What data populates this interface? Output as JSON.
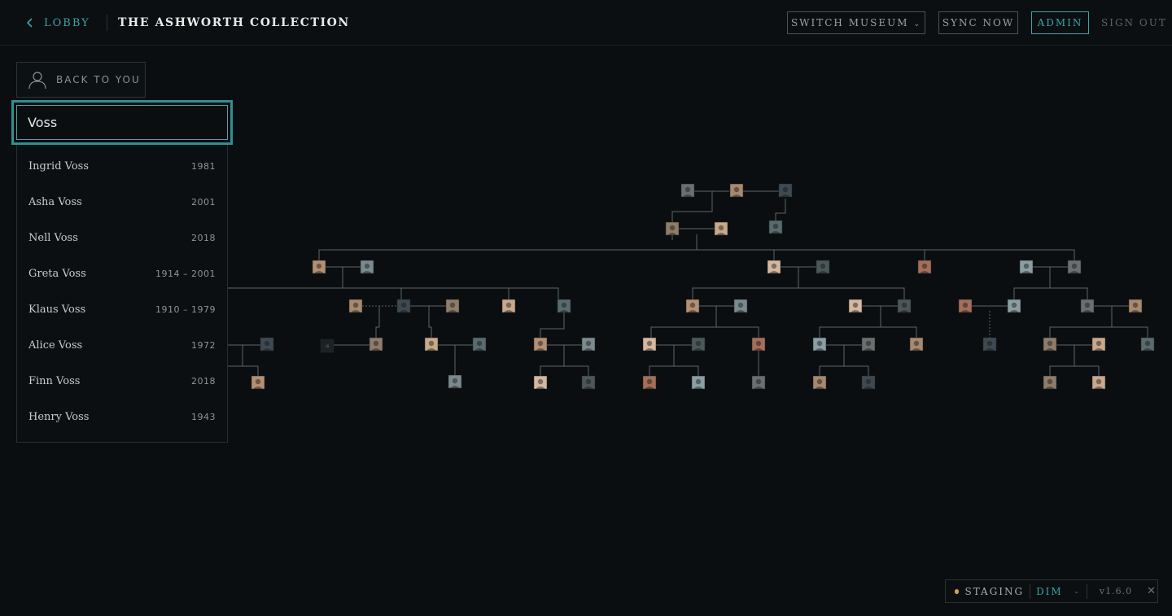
{
  "header": {
    "lobby_label": "LOBBY",
    "title": "THE ASHWORTH COLLECTION",
    "switch_museum_label": "SWITCH MUSEUM",
    "sync_label": "SYNC NOW",
    "admin_label": "ADMIN",
    "signout_label": "SIGN OUT"
  },
  "sidebar": {
    "back_label": "BACK TO YOU",
    "search_value": "Voss",
    "results": [
      {
        "name": "Ingrid Voss",
        "years": "1981"
      },
      {
        "name": "Asha Voss",
        "years": "2001"
      },
      {
        "name": "Nell Voss",
        "years": "2018"
      },
      {
        "name": "Greta Voss",
        "years": "1914 – 2001"
      },
      {
        "name": "Klaus Voss",
        "years": "1910 – 1979"
      },
      {
        "name": "Alice Voss",
        "years": "1972"
      },
      {
        "name": "Finn Voss",
        "years": "2018"
      },
      {
        "name": "Henry Voss",
        "years": "1943"
      }
    ]
  },
  "status": {
    "env_label": "STAGING",
    "mode_label": "DIM",
    "version": "v1.6.0",
    "env_color": "#d4a04a",
    "accent": "#3aa4a8"
  },
  "tree": {
    "placeholder_initials": "LB"
  }
}
